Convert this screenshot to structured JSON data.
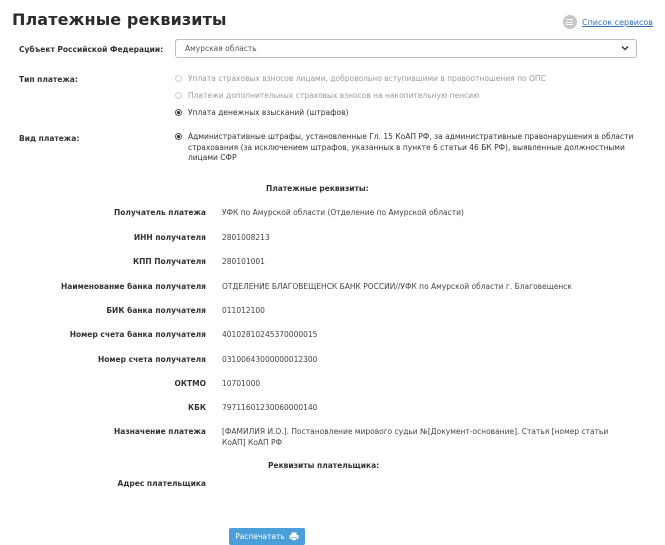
{
  "page_title": "Платежные реквизиты",
  "services_link": "Список сервисов",
  "subject": {
    "label": "Субъект Российской Федерации:",
    "value": "Амурская область"
  },
  "payment_type": {
    "label": "Тип платежа:",
    "options": [
      {
        "label": "Уплата страховых взносов лицами, добровольно вступившими в правоотношения по ОПС",
        "selected": false
      },
      {
        "label": "Платежи дополнительных страховых взносов на накопительную пенсию",
        "selected": false
      },
      {
        "label": "Уплата денежных взысканий (штрафов)",
        "selected": true
      }
    ]
  },
  "payment_kind": {
    "label": "Вид платежа:",
    "value": "Административные штрафы, установленные Гл. 15 КоАП РФ, за административные правонарушения в области страхования (за исключением штрафов, указанных в пункте 6 статьи 46 БК РФ), выявленные должностными лицами СФР",
    "selected": true
  },
  "requisites_title": "Платежные реквизиты:",
  "requisites": [
    {
      "label": "Получатель платежа",
      "value": "УФК по Амурской области (Отделение по Амурской области)"
    },
    {
      "label": "ИНН получателя",
      "value": "2801008213"
    },
    {
      "label": "КПП Получателя",
      "value": "280101001"
    },
    {
      "label": "Наименование банка получателя",
      "value": "ОТДЕЛЕНИЕ БЛАГОВЕЩЕНСК БАНК РОССИИ//УФК по Амурской области г. Благовещенск"
    },
    {
      "label": "БИК банка получателя",
      "value": "011012100"
    },
    {
      "label": "Номер счета банка получателя",
      "value": "40102810245370000015"
    },
    {
      "label": "Номер счета получателя",
      "value": "03100643000000012300"
    },
    {
      "label": "ОКТМО",
      "value": "10701000"
    },
    {
      "label": "КБК",
      "value": "79711601230060000140"
    },
    {
      "label": "Назначение платежа",
      "value": "[ФАМИЛИЯ И.О.]. Постановление мирового судьи №[Документ-основание]. Статья [номер статьи КоАП] КоАП РФ"
    }
  ],
  "payer_title": "Реквизиты плательщика:",
  "payer_address_label": "Адрес плательщика",
  "print_button": "Распечатать",
  "colors": {
    "link": "#2d6fb5",
    "button": "#4a9fd8"
  }
}
